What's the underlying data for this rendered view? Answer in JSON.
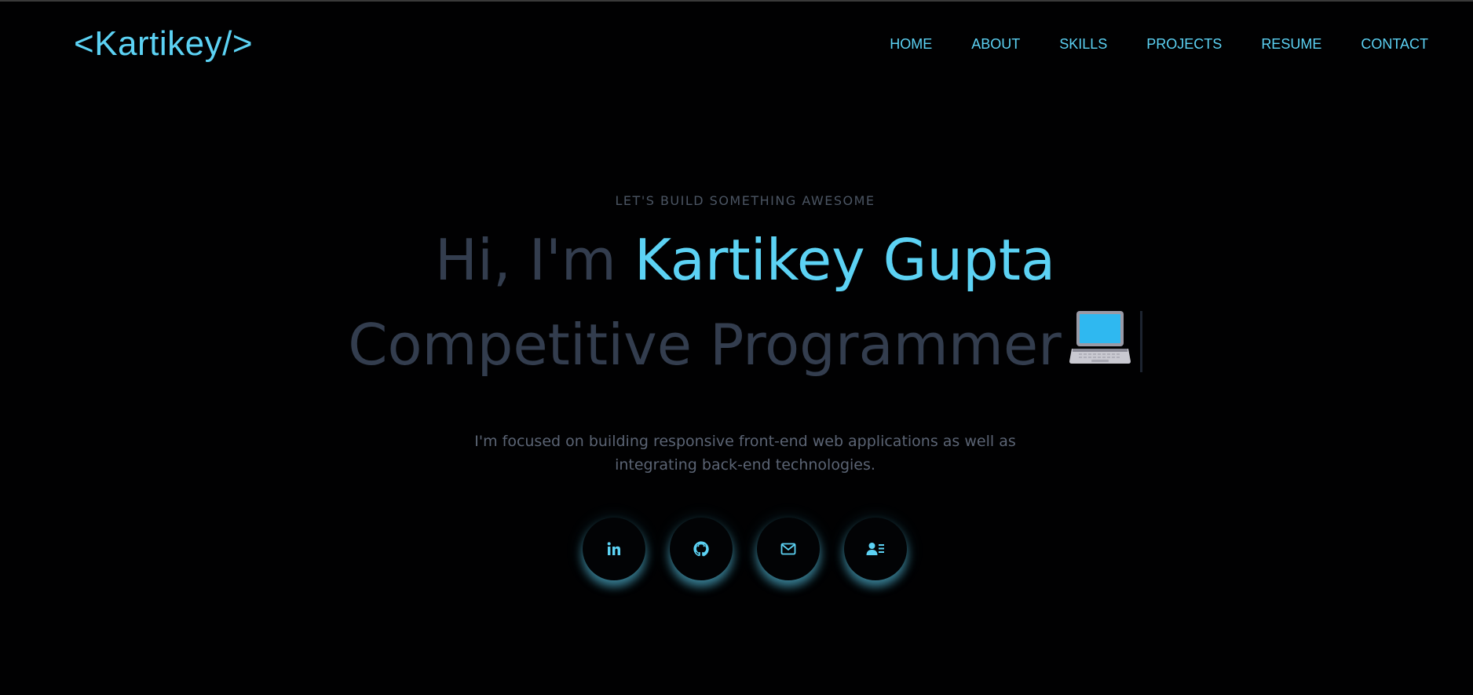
{
  "header": {
    "logo": "<Kartikey/>",
    "nav": [
      {
        "label": "HOME"
      },
      {
        "label": "ABOUT"
      },
      {
        "label": "SKILLS"
      },
      {
        "label": "PROJECTS"
      },
      {
        "label": "RESUME"
      },
      {
        "label": "CONTACT"
      }
    ]
  },
  "hero": {
    "eyebrow": "LET'S BUILD SOMETHING AWESOME",
    "greeting": "Hi, I'm",
    "name": "Kartikey Gupta",
    "role": "Competitive Programmer",
    "role_icon": "laptop-emoji",
    "description": "I'm focused on building responsive front-end web applications as well as integrating back-end technologies."
  },
  "socials": [
    {
      "icon": "linkedin-icon"
    },
    {
      "icon": "github-icon"
    },
    {
      "icon": "mail-icon"
    },
    {
      "icon": "contact-card-icon"
    }
  ],
  "colors": {
    "background": "#010102",
    "accent": "#5cd2f4",
    "muted_heading": "#333d4e",
    "muted_text": "#5b6474"
  }
}
